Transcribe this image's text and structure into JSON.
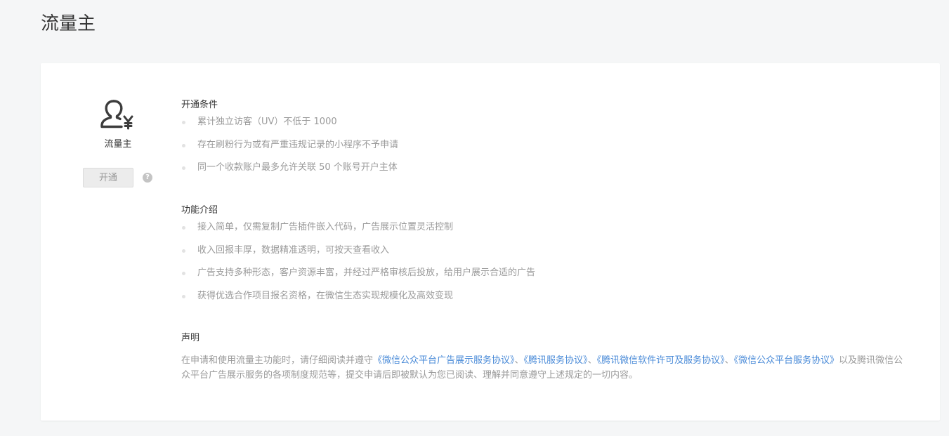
{
  "page": {
    "title": "流量主"
  },
  "product": {
    "name": "流量主",
    "icon": "user-yuan-icon",
    "open_label": "开通",
    "help_icon": "question-circle-icon"
  },
  "conditions": {
    "title": "开通条件",
    "items": [
      "累计独立访客（UV）不低于 1000",
      "存在刷粉行为或有严重违规记录的小程序不予申请",
      "同一个收款账户最多允许关联 50 个账号开户主体"
    ]
  },
  "features": {
    "title": "功能介绍",
    "items": [
      "接入简单，仅需复制广告插件嵌入代码，广告展示位置灵活控制",
      "收入回报丰厚，数据精准透明，可按天查看收入",
      "广告支持多种形态，客户资源丰富，并经过严格审核后投放，给用户展示合适的广告",
      "获得优选合作项目报名资格，在微信生态实现规模化及高效变现"
    ]
  },
  "statement": {
    "title": "声明",
    "prefix": "在申请和使用流量主功能时，请仔细阅读并遵守",
    "link1": "《微信公众平台广告展示服务协议》",
    "sep1": "、",
    "link2": "《腾讯服务协议》",
    "sep2": "、",
    "link3": "《腾讯微信软件许可及服务协议》",
    "sep3": "、",
    "link4": "《微信公众平台服务协议》",
    "suffix": "以及腾讯微信公众平台广告展示服务的各项制度规范等，提交申请后即被默认为您已阅读、理解并同意遵守上述规定的一切内容。"
  },
  "colors": {
    "background": "#f5f6f7",
    "card": "#ffffff",
    "link": "#4a8bd8",
    "muted_text": "#9a9a9a",
    "dark_text": "#353535"
  }
}
